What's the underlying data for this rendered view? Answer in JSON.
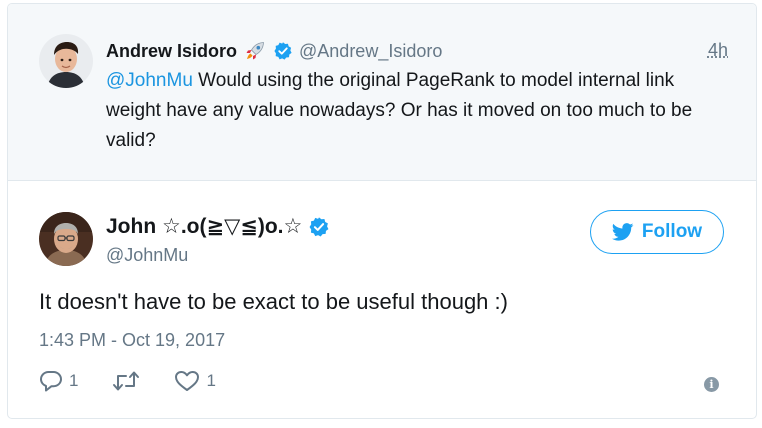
{
  "parent_tweet": {
    "author_name": "Andrew Isidoro",
    "author_emoji": "rocket-icon",
    "handle": "@Andrew_Isidoro",
    "time": "4h",
    "mention": "@JohnMu",
    "text": " Would using the original PageRank to model internal link weight have any value nowadays? Or has it moved on too much to be valid?"
  },
  "main_tweet": {
    "author_name": "John ☆.o(≧▽≦)o.☆",
    "handle": "@JohnMu",
    "follow_label": "Follow",
    "text": "It doesn't have to be exact to be useful though :)",
    "timestamp": "1:43 PM - Oct 19, 2017",
    "reply_count": "1",
    "like_count": "1",
    "info_glyph": "i"
  },
  "colors": {
    "accent": "#1da1f2",
    "link": "#1b95e0",
    "muted": "#657786",
    "parent_bg": "#f5f8fa",
    "border": "#e1e8ed"
  }
}
